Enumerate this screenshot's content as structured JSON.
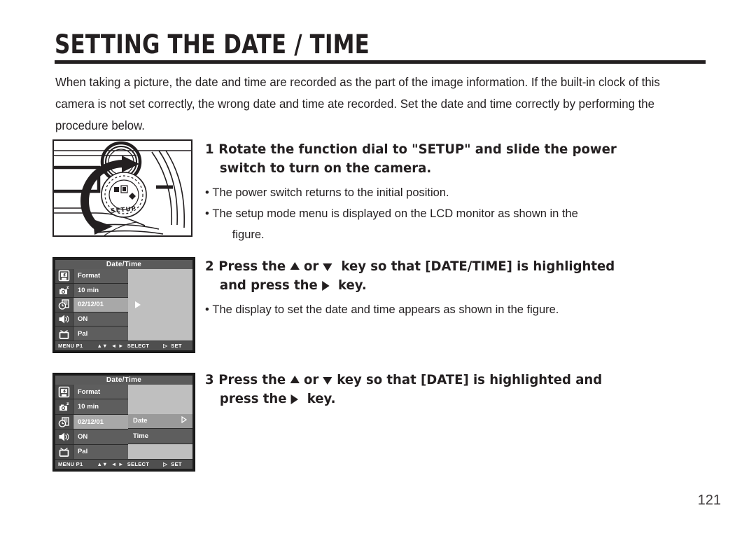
{
  "page": {
    "title": "SETTING THE DATE / TIME",
    "number": "121",
    "intro": "When taking a picture, the date and time are recorded as the part of the image information. If the built-in clock of this camera is not set correctly, the wrong date and time ate recorded. Set the date and time correctly by performing the procedure below."
  },
  "steps": [
    {
      "number": "1",
      "head_line1": "Rotate the function dial to \"SETUP\" and slide the power",
      "head_line2": "switch to turn on the camera.",
      "bullets": [
        {
          "text": "The power switch returns to the initial position.",
          "cont": ""
        },
        {
          "text": "The setup mode menu is displayed on the LCD monitor as shown in the",
          "cont": "figure."
        }
      ]
    },
    {
      "number": "2",
      "head_a": "Press the",
      "head_b": "or",
      "head_c": "key so that [DATE/TIME] is highlighted",
      "head_d": "and press the",
      "head_e": "key.",
      "bullets": [
        {
          "text": "The display to set the date and time appears as shown in the figure.",
          "cont": ""
        }
      ]
    },
    {
      "number": "3",
      "head_a": "Press the",
      "head_b": "or",
      "head_c": "key so that [DATE] is highlighted and",
      "head_d": "press the",
      "head_e": "key.",
      "bullets": []
    }
  ],
  "camera_figure": {
    "dial_label": "SETUP",
    "alt": "Camera top showing function dial rotated to SETUP and power switch"
  },
  "lcd1": {
    "title": "Date/Time",
    "rows": [
      {
        "icon": "format-card-icon",
        "label": "Format",
        "selected": false
      },
      {
        "icon": "camera-sleep-icon",
        "label": "10 min",
        "selected": false
      },
      {
        "icon": "clock-date-icon",
        "label": "02/12/01",
        "selected": true
      },
      {
        "icon": "speaker-icon",
        "label": "ON",
        "selected": false
      },
      {
        "icon": "tv-output-icon",
        "label": "Pal",
        "selected": false
      }
    ],
    "right_panel": {
      "arrow": "solid-right-arrow-icon"
    },
    "footer": {
      "menu": "MENU P1",
      "updown": "▲▼",
      "leftright": "◄ ►",
      "select": "SELECT",
      "set_arrow": "▷",
      "set": "SET"
    }
  },
  "lcd2": {
    "title": "Date/Time",
    "rows": [
      {
        "icon": "format-card-icon",
        "label": "Format",
        "selected": false
      },
      {
        "icon": "camera-sleep-icon",
        "label": "10 min",
        "selected": false
      },
      {
        "icon": "clock-date-icon",
        "label": "02/12/01",
        "selected": true
      },
      {
        "icon": "speaker-icon",
        "label": "ON",
        "selected": false
      },
      {
        "icon": "tv-output-icon",
        "label": "Pal",
        "selected": false
      }
    ],
    "submenu": [
      {
        "label": "",
        "kind": "filler"
      },
      {
        "label": "",
        "kind": "filler"
      },
      {
        "label": "Date",
        "kind": "selected",
        "arrow": "outline-right-arrow-icon"
      },
      {
        "label": "Time",
        "kind": "dark",
        "arrow": ""
      },
      {
        "label": "",
        "kind": "filler"
      }
    ],
    "footer": {
      "menu": "MENU P1",
      "updown": "▲▼",
      "leftright": "◄ ►",
      "select": "SELECT",
      "set_arrow": "▷",
      "set": "SET"
    }
  },
  "colors": {
    "ink": "#231f20",
    "lcd_bezel": "#1d1d1d",
    "lcd_row": "#5e5e5e",
    "lcd_row_selected": "#a8a8a8",
    "lcd_panel": "#bfbfbf",
    "lcd_title_bar": "#5b5b5b"
  }
}
